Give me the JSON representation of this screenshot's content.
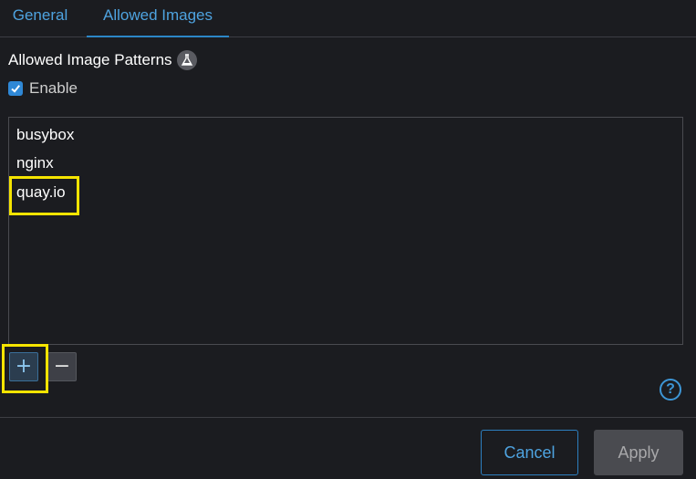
{
  "tabs": [
    {
      "label": "General",
      "active": false
    },
    {
      "label": "Allowed Images",
      "active": true
    }
  ],
  "section": {
    "title": "Allowed Image Patterns",
    "experimental_icon": "flask-icon"
  },
  "enable": {
    "label": "Enable",
    "checked": true
  },
  "patterns": [
    "busybox",
    "nginx",
    "quay.io"
  ],
  "controls": {
    "add_glyph": "+",
    "remove_glyph": "−",
    "help_glyph": "?"
  },
  "footer": {
    "cancel_label": "Cancel",
    "apply_label": "Apply"
  },
  "colors": {
    "accent": "#2f88d6",
    "highlight": "#f5e400",
    "background": "#1b1c20"
  }
}
